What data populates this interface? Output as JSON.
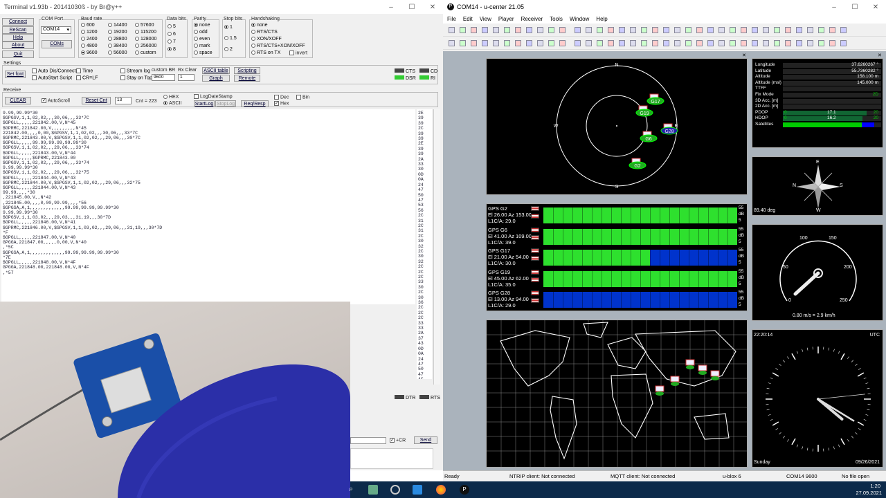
{
  "terminal": {
    "title": "Terminal v1.93b - 20141030ß - by Br@y++",
    "buttons": {
      "connect": "Connect",
      "rescan": "ReScan",
      "help": "Help",
      "about": "About",
      "quit": "Quit",
      "coms": "COMs",
      "set_font": "Set font",
      "clear": "CLEAR",
      "reset_cnt": "Reset Cnt",
      "graph": "Graph",
      "remote": "Remote",
      "ascii_table": "ASCII table",
      "scripting": "Scripting",
      "start_log": "StartLog",
      "stop_log": "StopLog",
      "req_resp": "Req/Resp",
      "send": "Send"
    },
    "com_port_label": "COM Port",
    "com_port_value": "COM14",
    "baud_label": "Baud rate",
    "baud_options": [
      "600",
      "1200",
      "2400",
      "4800",
      "9600",
      "14400",
      "19200",
      "28800",
      "38400",
      "56000",
      "57600",
      "115200",
      "128000",
      "256000",
      "custom"
    ],
    "baud_selected": "9600",
    "databits_label": "Data bits",
    "databits_options": [
      "5",
      "6",
      "7",
      "8"
    ],
    "parity_label": "Parity",
    "parity_options": [
      "none",
      "odd",
      "even",
      "mark",
      "space"
    ],
    "stopbits_label": "Stop bits",
    "stopbits_options": [
      "1",
      "1.5",
      "2"
    ],
    "handshaking_label": "Handshaking",
    "handshaking_options": [
      "none",
      "RTS/CTS",
      "XON/XOFF",
      "RTS/CTS+XON/XOFF",
      "RTS on TX"
    ],
    "invert_label": "invert",
    "settings_label": "Settings",
    "settings_checks": [
      "Auto Dis/Connect",
      "AutoStart Script",
      "Time",
      "CR=LF",
      "Stream log",
      "Stay on Top"
    ],
    "custom_br_label": "custom BR",
    "custom_br_value": "9600",
    "rx_clear_label": "Rx Clear",
    "rx_clear_value": "1",
    "signals": [
      "CTS",
      "DSR",
      "CD",
      "RI"
    ],
    "receive_label": "Receive",
    "autoscroll_label": "AutoScroll",
    "cnt_value": "13",
    "cnt_label": "Cnt = 223",
    "hex_label": "HEX",
    "ascii_label": "ASCII",
    "log_date_stamp": "LogDateStamp",
    "dec_label": "Dec",
    "hex2_label": "Hex",
    "bin_label": "Bin",
    "dtr_label": "DTR",
    "rts_label": "RTS",
    "cr_label": "+CR",
    "log_lines": [
      "9.99,99.99*30",
      "$GPGSV,1,1,02,02,,,30,06,,,33*7C",
      "$GPGLL,,,,,221842.00,V,N*45",
      "$GPRMC,221842.00,V,,,,,,,,,N*45",
      "221842.00,,,,0,00,$GPGSV,1,1,02,02,,,30,06,,,33*7C",
      "$GPRMC,221843.00,V,$GPGSV,1,1,02,02,,,29,06,,,30*7C",
      "$GPGLL,,,,,99.99,99.99,99.99*30",
      "$GPGSV,1,1,02,02,,,29,06,,,33*74",
      "$GPGLL,,,,,221843.00,V,N*44",
      "$GPGLL,,,,,$GPRMC,221843.00",
      "$GPGSV,1,1,02,02,,,29,06,,,33*74",
      "9.99,99.99*30",
      "$GPGSV,1,1,02,02,,,29,06,,,32*75",
      "$GPGLL,,,,,221844.00,V,N*43",
      "$GPRMC,221844.00,V,$GPGSV,1,1,02,02,,,29,06,,,32*75",
      "$GPGLL,,,,,221844.00,V,N*43",
      "99.99,,,,*30",
      ",221845.00,V,,N*42",
      ",221845.00,,,,0,00,99.99,,,,*56",
      "$GPGSA,A,1,,,,,,,,,,,,,99.99,99.99,99.99*30",
      "9.99,99.99*30",
      "$GPGSV,1,1,03,02,,,29,03,,,31,19,,,30*7D",
      "$GPGLL,,,,,221846.00,V,N*41",
      "$GPRMC,221846.00,V,$GPGSV,1,1,03,02,,,29,06,,,31,19,,,30*7D",
      "*F",
      "$GPGLL,,,,,221847.00,V,N*40",
      "GPGGA,221847.00,,,,,0,00,V,N*40",
      ",*5C",
      "$GPGSA,A,1,,,,,,,,,,,,,99.99,99.99,99.99*30",
      "*7E",
      "$GPGLL,,,,,221848.00,V,N*4F",
      "GPGGA,221848.00,221848.00,V,N*4F",
      ",*57"
    ],
    "hex_lines": [
      "2E",
      "39",
      "39",
      "2C",
      "39",
      "39",
      "2E",
      "39",
      "39",
      "2A",
      "33",
      "30",
      "0D",
      "0A",
      "24",
      "47",
      "50",
      "47",
      "53",
      "56",
      "2C",
      "31",
      "2C",
      "31",
      "2C",
      "30",
      "32",
      "2C",
      "30",
      "32",
      "2C",
      "2C",
      "2C",
      "33",
      "30",
      "2C",
      "30",
      "36",
      "2C",
      "2C",
      "2C",
      "33",
      "33",
      "2A",
      "37",
      "43",
      "0D",
      "0A",
      "24",
      "47",
      "50",
      "47",
      "4C",
      "4C",
      "2C",
      "2C",
      "2C",
      "2C"
    ]
  },
  "ucenter": {
    "title": "COM14 - u-center 21.05",
    "menu": [
      "File",
      "Edit",
      "View",
      "Player",
      "Receiver",
      "Tools",
      "Window",
      "Help"
    ],
    "nav": {
      "Longitude": "37.6260267 °",
      "Latitude": "55.7360282 °",
      "Altitude": "158.100 m",
      "Altitude (msl)": "145.000 m",
      "TTFF": "",
      "Fix Mode": "2D",
      "3D Acc. [m]": "",
      "2D Acc. [m]": "",
      "PDOP": "17.1",
      "HDOP": "16.2",
      "Satellites": ""
    },
    "nav_fractions": {
      "PDOP": 0.855,
      "HDOP": 0.81,
      "Satellites": 0.8
    },
    "nav_scale": {
      "min": "0",
      "max": "20"
    },
    "sky_labels": {
      "n": "N",
      "s": "S",
      "e": "E",
      "w": "W"
    },
    "sky_sats": [
      "G17",
      "G19",
      "G28",
      "G6",
      "G2"
    ],
    "signals": [
      {
        "name": "GPS G2",
        "elaz": "El 26.00 Az 153.00",
        "cno": "L1C/A: 29.0",
        "green_frac": 1.0
      },
      {
        "name": "GPS G6",
        "elaz": "El 41.00 Az 109.00",
        "cno": "L1C/A: 39.0",
        "green_frac": 1.0
      },
      {
        "name": "GPS G17",
        "elaz": "El 21.00 Az 54.00",
        "cno": "L1C/A: 30.0",
        "green_frac": 0.55
      },
      {
        "name": "GPS G19",
        "elaz": "El 45.00 Az 62.00",
        "cno": "L1C/A: 35.0",
        "green_frac": 1.0
      },
      {
        "name": "GPS G28",
        "elaz": "El 13.00 Az 94.00",
        "cno": "L1C/A: 29.0",
        "green_frac": 0.0
      }
    ],
    "scale_labels": {
      "top": "55",
      "unit": "dB",
      "bottom": "5"
    },
    "compass": {
      "n": "N",
      "e": "E",
      "s": "S",
      "w": "W",
      "heading": "89.40 deg"
    },
    "speedo": {
      "ticks": [
        "0",
        "50",
        "100",
        "150",
        "200",
        "250"
      ],
      "reading": "0.80 m/s = 2.9 km/h"
    },
    "clock": {
      "time": "22:20:14",
      "zone": "UTC",
      "day": "Sunday",
      "date": "09/26/2021"
    },
    "status": {
      "ready": "Ready",
      "ntrip": "NTRIP client: Not connected",
      "mqtt": "MQTT client: Not connected",
      "device": "u-blox 6",
      "port": "COM14 9600",
      "file": "No file open"
    }
  },
  "taskbar": {
    "time": "1:20",
    "date": "27.09.2021"
  }
}
